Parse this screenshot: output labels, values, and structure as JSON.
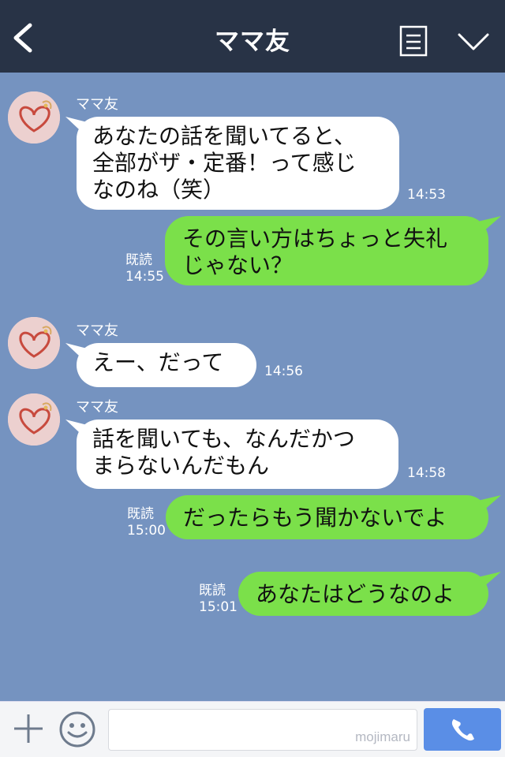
{
  "header": {
    "title": "ママ友",
    "icons": [
      "back-icon",
      "memo-icon",
      "chevron-down-icon"
    ]
  },
  "colors": {
    "header_bg": "#283346",
    "chat_bg": "#7593c0",
    "incoming_bubble": "#ffffff",
    "outgoing_bubble": "#7be04a",
    "call_button": "#5a8ee6"
  },
  "messages": [
    {
      "direction": "in",
      "sender": "ママ友",
      "text": "あなたの話を聞いてると、\n全部がザ・定番！って感じ\nなのね（笑）",
      "time": "14:53"
    },
    {
      "direction": "out",
      "text": "その言い方はちょっと失礼\nじゃない？",
      "read": "既読",
      "time": "14:55"
    },
    {
      "direction": "in",
      "sender": "ママ友",
      "text": "えー、だって",
      "time": "14:56"
    },
    {
      "direction": "in",
      "sender": "ママ友",
      "text": "話を聞いても、なんだかつ\nまらないんだもん",
      "time": "14:58"
    },
    {
      "direction": "out",
      "text": "だったらもう聞かないでよ",
      "read": "既読",
      "time": "15:00"
    },
    {
      "direction": "out",
      "text": "あなたはどうなのよ",
      "read": "既読",
      "time": "15:01"
    }
  ],
  "footer": {
    "input_value": "",
    "watermark": "mojimaru",
    "icons": [
      "plus-icon",
      "smiley-icon",
      "phone-icon"
    ]
  }
}
